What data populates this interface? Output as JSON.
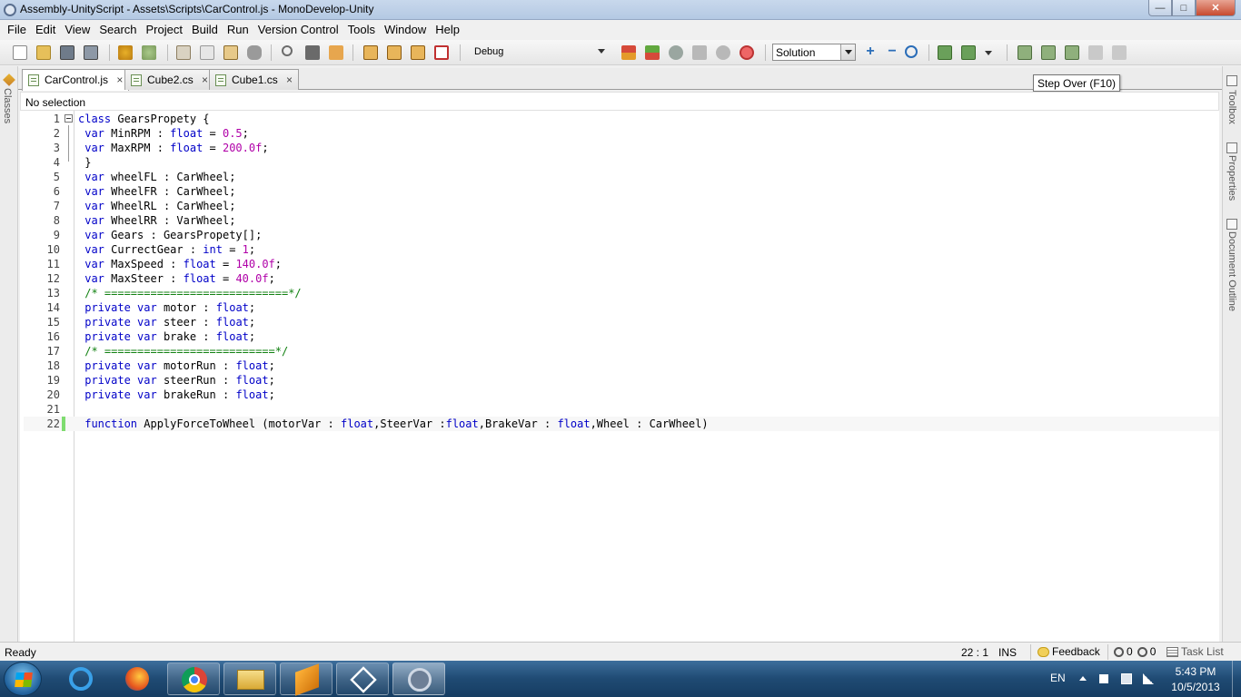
{
  "window": {
    "title": "Assembly-UnityScript - Assets\\Scripts\\CarControl.js - MonoDevelop-Unity",
    "min": "—",
    "max": "□",
    "close": "✕"
  },
  "menu": [
    "File",
    "Edit",
    "View",
    "Search",
    "Project",
    "Build",
    "Run",
    "Version Control",
    "Tools",
    "Window",
    "Help"
  ],
  "toolbar": {
    "configuration": "Debug",
    "solution_selector": "Solution"
  },
  "tooltip": "Step Over (F10)",
  "left_pad": {
    "classes_label": "Classes"
  },
  "right_pads": [
    "Toolbox",
    "Properties",
    "Document Outline"
  ],
  "tabs": [
    {
      "label": "CarControl.js",
      "close": "×"
    },
    {
      "label": "Cube2.cs",
      "close": "×"
    },
    {
      "label": "Cube1.cs",
      "close": "×"
    }
  ],
  "path_bar": "No selection",
  "code_lines": [
    "class GearsPropety {",
    " var MinRPM : float = 0.5;",
    " var MaxRPM : float = 200.0f;",
    " }",
    " var wheelFL : CarWheel;",
    " var WheelFR : CarWheel;",
    " var WheelRL : CarWheel;",
    " var WheelRR : VarWheel;",
    " var Gears : GearsPropety[];",
    " var CurrectGear : int = 1;",
    " var MaxSpeed : float = 140.0f;",
    " var MaxSteer : float = 40.0f;",
    " /* ============================*/",
    " private var motor : float;",
    " private var steer : float;",
    " private var brake : float;",
    " /* ==========================*/",
    " private var motorRun : float;",
    " private var steerRun : float;",
    " private var brakeRun : float;",
    "",
    " function ApplyForceToWheel (motorVar : float,SteerVar :float,BrakeVar : float,Wheel : CarWheel)"
  ],
  "status": {
    "ready": "Ready",
    "position": "22 : 1",
    "mode": "INS",
    "feedback": "Feedback",
    "errors": "0",
    "warnings": "0",
    "task_list": "Task List"
  },
  "taskbar": {
    "language": "EN",
    "time": "5:43 PM",
    "date": "10/5/2013"
  }
}
